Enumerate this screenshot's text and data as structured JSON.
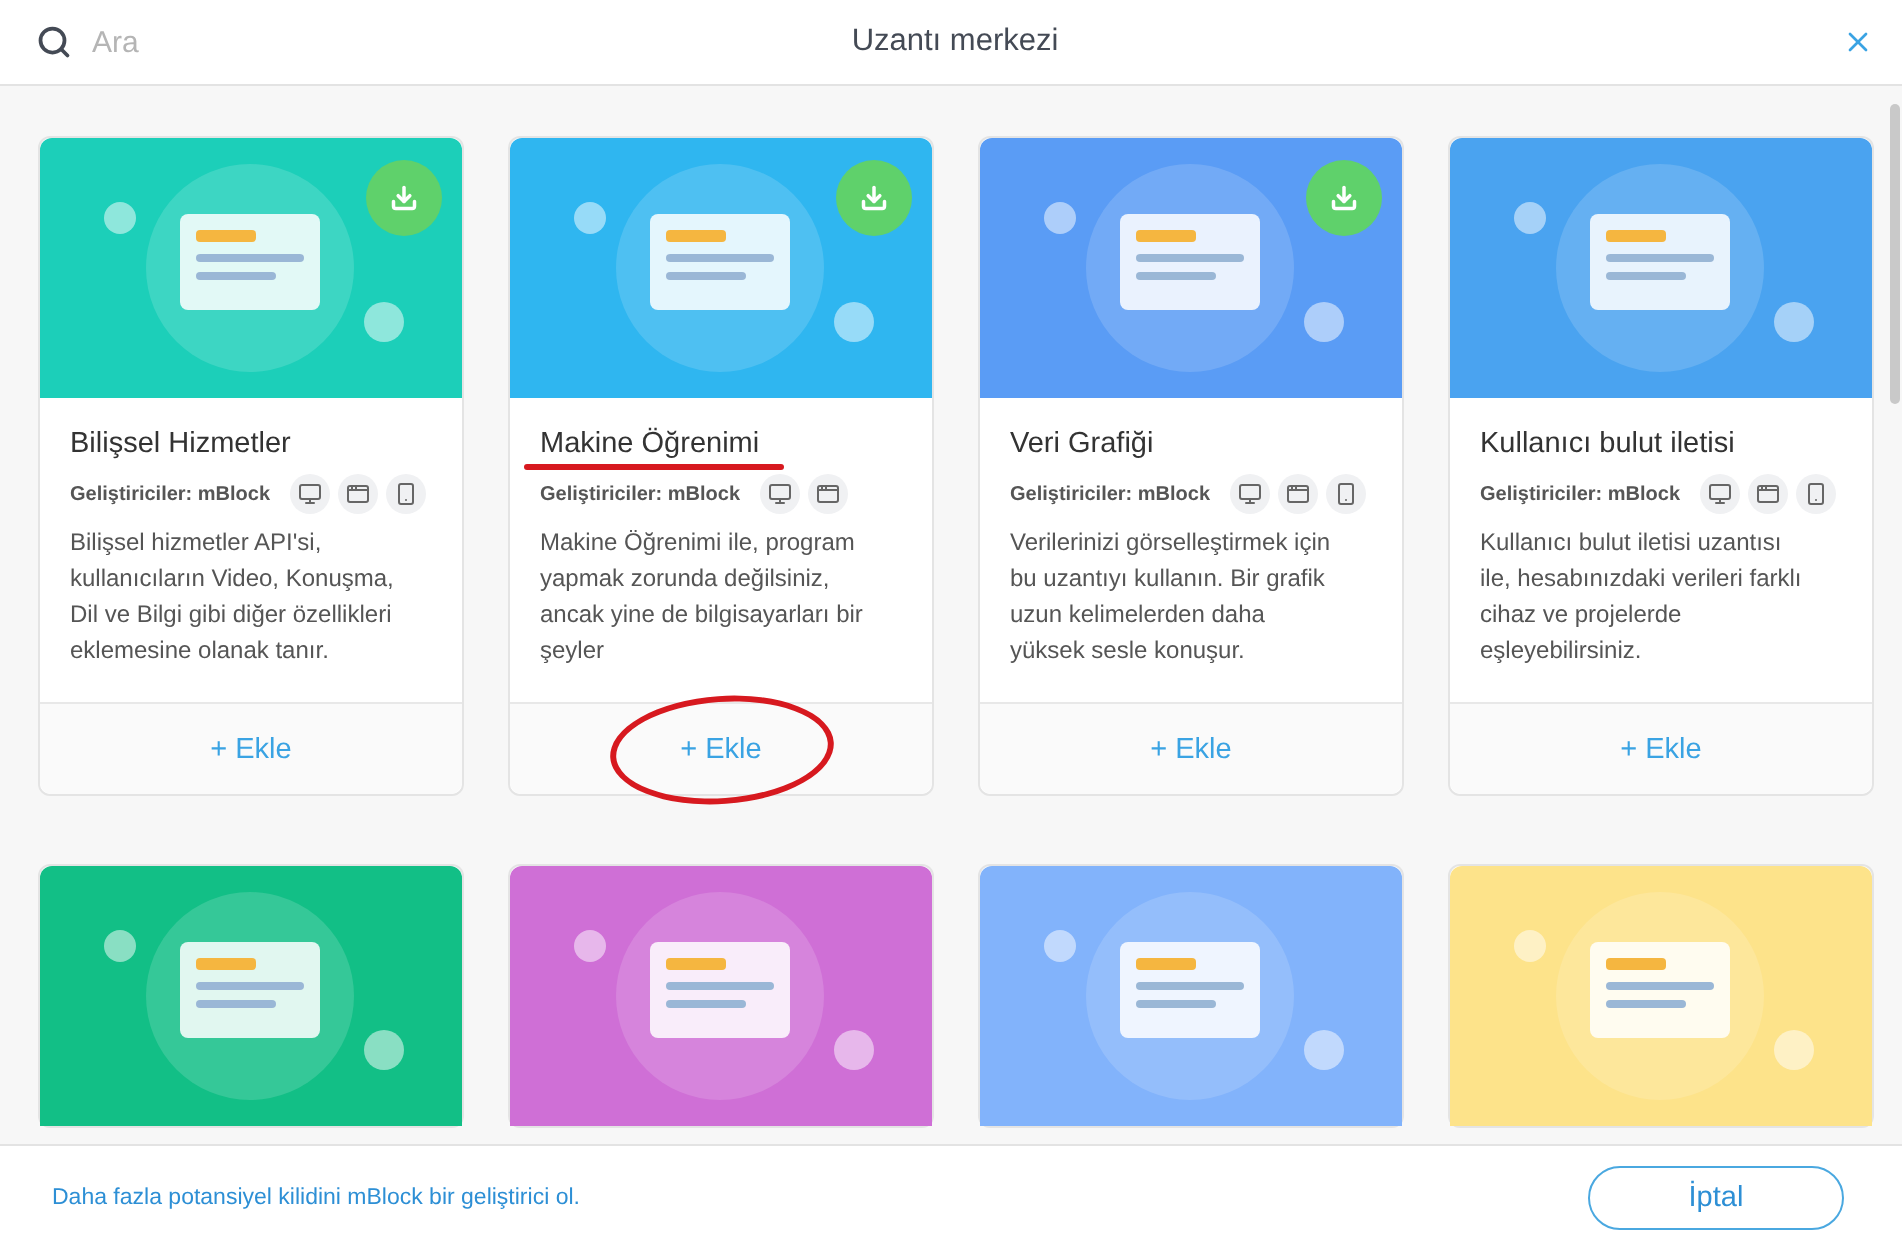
{
  "header": {
    "search": {
      "placeholder": "Ara"
    },
    "title": "Uzantı merkezi"
  },
  "cards": [
    {
      "color": "#1ccfb9",
      "downloadable": true,
      "title": "Bilişsel Hizmetler",
      "developer": "Geliştiriciler: mBlock",
      "platforms": [
        {
          "kind": "desktop"
        },
        {
          "kind": "browser"
        },
        {
          "kind": "mobile"
        }
      ],
      "description": "Bilişsel hizmetler API'si, kullanıcıların Video, Konuşma, Dil ve Bilgi gibi diğer özellikleri eklemesine olanak tanır.",
      "add_label": "+ Ekle",
      "annotated": false
    },
    {
      "color": "#2fb6f0",
      "downloadable": true,
      "title": "Makine Öğrenimi",
      "developer": "Geliştiriciler: mBlock",
      "platforms": [
        {
          "kind": "desktop"
        },
        {
          "kind": "browser"
        }
      ],
      "description": "Makine Öğrenimi ile, program yapmak zorunda değilsiniz, ancak yine de bilgisayarları bir şeyler",
      "add_label": "+ Ekle",
      "annotated": true
    },
    {
      "color": "#5a9cf5",
      "downloadable": true,
      "title": "Veri Grafiği",
      "developer": "Geliştiriciler: mBlock",
      "platforms": [
        {
          "kind": "desktop"
        },
        {
          "kind": "browser"
        },
        {
          "kind": "mobile"
        }
      ],
      "description": "Verilerinizi görselleştirmek için bu uzantıyı kullanın. Bir grafik uzun kelimelerden daha yüksek sesle konuşur.",
      "add_label": "+ Ekle",
      "annotated": false
    },
    {
      "color": "#4aa3f0",
      "downloadable": false,
      "title": "Kullanıcı bulut iletisi",
      "developer": "Geliştiriciler: mBlock",
      "platforms": [
        {
          "kind": "desktop"
        },
        {
          "kind": "browser"
        },
        {
          "kind": "mobile"
        }
      ],
      "description": "Kullanıcı bulut iletisi uzantısı ile, hesabınızdaki verileri farklı cihaz ve projelerde eşleyebilirsiniz.",
      "add_label": "+ Ekle",
      "annotated": false
    },
    {
      "color": "#12bf86"
    },
    {
      "color": "#cf6fd6"
    },
    {
      "color": "#82b3fb"
    },
    {
      "color": "#fde38a"
    }
  ],
  "footer": {
    "promo_link": "Daha fazla potansiyel kilidini mBlock bir geliştirici ol.",
    "cancel_button": "İptal"
  }
}
